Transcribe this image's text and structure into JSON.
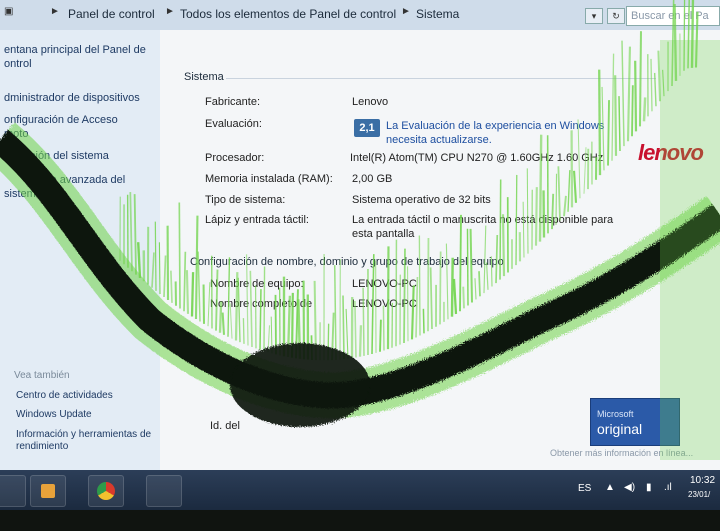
{
  "address_bar": {
    "crumbs": [
      "Panel de control",
      "Todos los elementos de Panel de control",
      "Sistema"
    ],
    "search_placeholder": "Buscar en el Pa"
  },
  "left_pane": {
    "links": [
      "entana principal del Panel de",
      "ontrol",
      "dministrador de dispositivos",
      "onfiguración de Acceso",
      "moto",
      "ción del sistema",
      "ión avanzada del",
      "sistema"
    ],
    "see_also_title": "Vea también",
    "see_also": [
      "Centro de actividades",
      "Windows Update",
      "Información y herramientas de",
      "rendimiento"
    ]
  },
  "system": {
    "section_title": "Sistema",
    "rows": [
      {
        "label": "Fabricante:",
        "value": "Lenovo"
      },
      {
        "label": "Evaluación:",
        "value": ""
      },
      {
        "label": "Procesador:",
        "value": "Intel(R) Atom(TM) CPU N270  @ 1.60GHz  1.60 GHz"
      },
      {
        "label": "Memoria instalada (RAM):",
        "value": "2,00 GB"
      },
      {
        "label": "Tipo de sistema:",
        "value": "Sistema operativo de 32 bits"
      },
      {
        "label": "Lápiz y entrada táctil:",
        "value": "La entrada táctil o manuscrita no está disponible para"
      },
      {
        "label": "",
        "value": "esta pantalla"
      }
    ],
    "wei_score": "2,1",
    "wei_link_1": "La Evaluación de la experiencia en Windows",
    "wei_link_2": "necesita actualizarse.",
    "logo": "lenovo"
  },
  "computer_name": {
    "section_title": "Configuración de nombre, dominio y grupo de trabajo del equipo",
    "rows": [
      {
        "label": "Nombre de equipo:",
        "value": "LENOVO-PC"
      },
      {
        "label": "Nombre completo de",
        "value": "LENOVO-PC"
      }
    ],
    "id_label": "Id. del"
  },
  "genuine": {
    "microsoft": "Microsoft",
    "original": "original",
    "more_info": "Obtener más información en línea..."
  },
  "taskbar": {
    "lang": "ES",
    "time": "10:32",
    "date": "23/01/"
  },
  "colors": {
    "glitch_green": "#6fd44a",
    "glitch_dark": "#0c150c",
    "lenovo_red": "#c8102e"
  }
}
